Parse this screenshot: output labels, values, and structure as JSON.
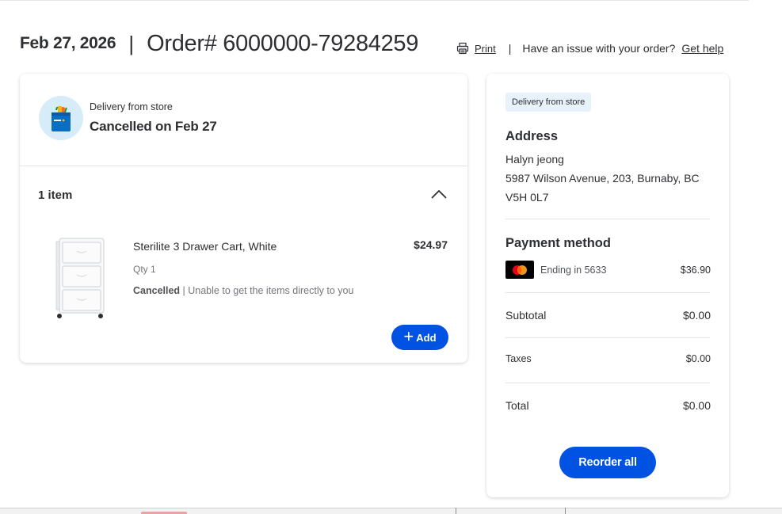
{
  "header": {
    "date": "Feb 27, 2026",
    "separator": "|",
    "order_number": "Order# 6000000-79284259",
    "print_label": "Print",
    "divider": "|",
    "issue_text": "Have an issue with your order?",
    "help_label": "Get help"
  },
  "order": {
    "delivery_type": "Delivery from store",
    "status_title": "Cancelled on Feb 27",
    "items_count": "1 item",
    "items": [
      {
        "name": "Sterilite 3 Drawer Cart, White",
        "price": "$24.97",
        "qty": "Qty 1",
        "status": "Cancelled",
        "status_detail": " | Unable to get the items directly to you",
        "add_label": "Add"
      }
    ]
  },
  "summary": {
    "pill": "Delivery from store",
    "address_title": "Address",
    "address_name": "Halyn jeong",
    "address_line1": "5987 Wilson Avenue, 203, Burnaby, BC",
    "address_line2": "V5H 0L7",
    "payment_title": "Payment method",
    "card_ending": "Ending in 5633",
    "card_amount": "$36.90",
    "subtotal_label": "Subtotal",
    "subtotal_value": "$0.00",
    "taxes_label": "Taxes",
    "taxes_value": "$0.00",
    "total_label": "Total",
    "total_value": "$0.00",
    "reorder_label": "Reorder all"
  },
  "colors": {
    "primary": "#0053e2",
    "pill_bg": "#e8f2fb",
    "icon_circle": "#d6ecf8"
  },
  "icons": [
    "print-icon",
    "shopping-bag-icon",
    "chevron-up-icon",
    "plus-icon",
    "mastercard-logo"
  ]
}
